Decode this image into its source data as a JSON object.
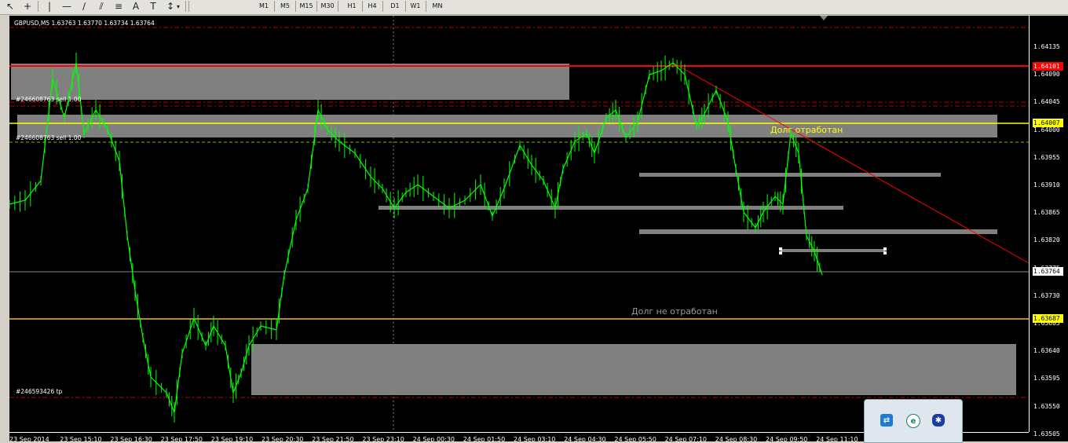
{
  "toolbar": {
    "timeframes": [
      "M1",
      "M5",
      "M15",
      "M30",
      "H1",
      "H4",
      "D1",
      "W1",
      "MN"
    ]
  },
  "chart": {
    "symbol_info": "GBPUSD,M5  1.63763 1.63770 1.63734 1.63764",
    "orders": [
      "#246608763 sell 1.00",
      "#246608763 sell 1.00",
      "#246593426 tp"
    ],
    "annotations": {
      "debt_worked": "Долг отработан",
      "debt_not_worked": "Долг не отработан"
    },
    "price_axis": [
      "1.64135",
      "1.64090",
      "1.64045",
      "1.64000",
      "1.63955",
      "1.63910",
      "1.63865",
      "1.63820",
      "1.63775",
      "1.63730",
      "1.63685",
      "1.63640",
      "1.63595",
      "1.63550",
      "1.63505"
    ],
    "price_tags": {
      "red": "1.64101",
      "yellow_top": "1.64007",
      "current": "1.63764",
      "yellow_bottom": "1.63687"
    },
    "time_axis": [
      "23 Sep 2014",
      "23 Sep 15:10",
      "23 Sep 16:30",
      "23 Sep 17:50",
      "23 Sep 19:10",
      "23 Sep 20:30",
      "23 Sep 21:50",
      "23 Sep 23:10",
      "24 Sep 00:30",
      "24 Sep 01:50",
      "24 Sep 03:10",
      "24 Sep 04:30",
      "24 Sep 05:50",
      "24 Sep 07:10",
      "24 Sep 08:30",
      "24 Sep 09:50",
      "24 Sep 11:10"
    ],
    "colors": {
      "background": "#000000",
      "candles": "#00ff00",
      "resistance": "#ff0000",
      "level": "#ffff00",
      "zones": "#808080"
    }
  },
  "tray": {
    "icons": [
      "teamviewer-icon",
      "browser-icon",
      "bluetooth-icon"
    ]
  }
}
